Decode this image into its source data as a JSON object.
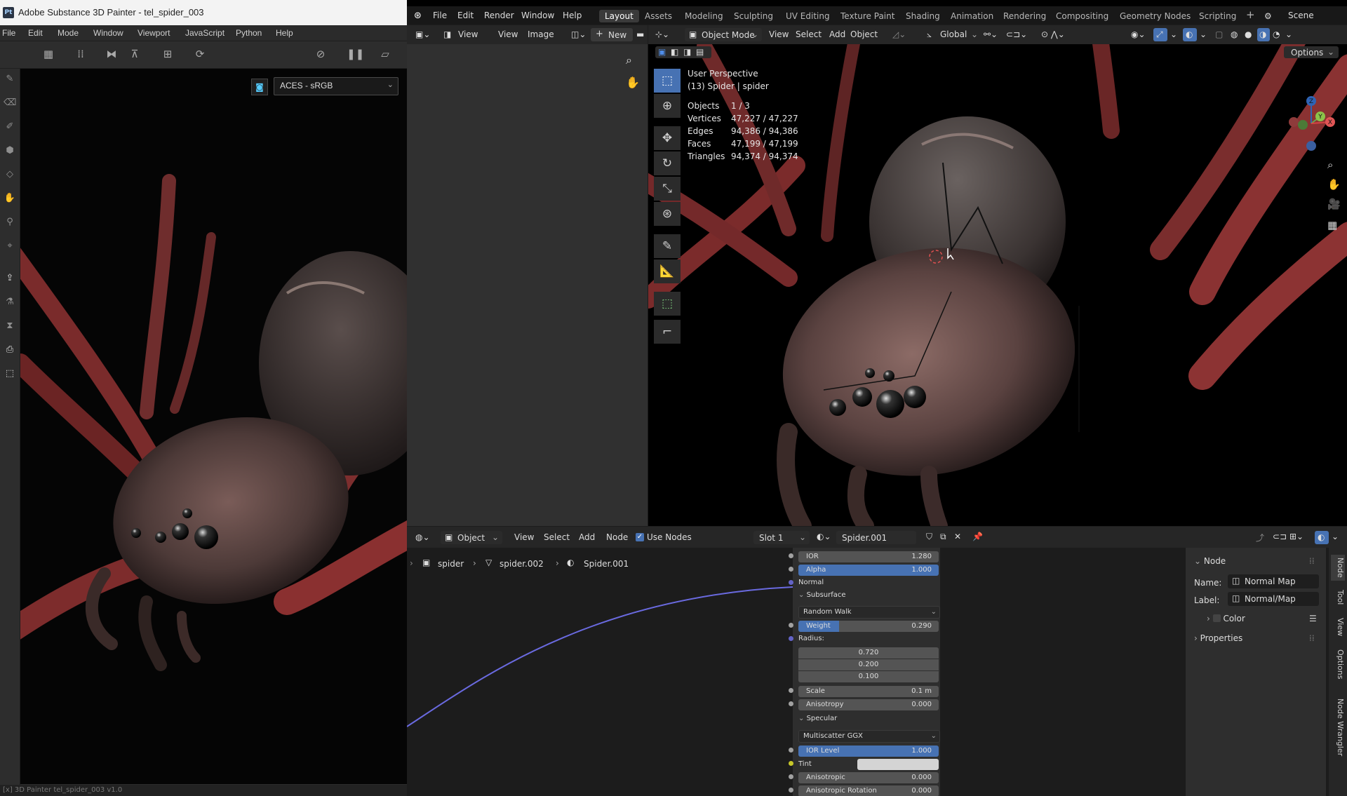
{
  "substance": {
    "title": "Adobe Substance 3D Painter - tel_spider_003",
    "logo": "Pt",
    "menu": [
      "File",
      "Edit",
      "Mode",
      "Window",
      "Viewport",
      "JavaScript",
      "Python",
      "Help"
    ],
    "colorspace": "ACES - sRGB",
    "status": "[x] 3D Painter   tel_spider_003   v1.0"
  },
  "blender": {
    "menu": [
      "File",
      "Edit",
      "Render",
      "Window",
      "Help"
    ],
    "workspaces": [
      "Layout",
      "Assets",
      "Modeling",
      "Sculpting",
      "UV Editing",
      "Texture Paint",
      "Shading",
      "Animation",
      "Rendering",
      "Compositing",
      "Geometry Nodes",
      "Scripting"
    ],
    "active_workspace": "Layout",
    "scene": "Scene",
    "image_editor": {
      "view1": "View",
      "view2": "View",
      "image": "Image",
      "new": "New"
    },
    "viewport": {
      "mode": "Object Mode",
      "menu": [
        "View",
        "Select",
        "Add",
        "Object"
      ],
      "transform": "Global",
      "options": "Options",
      "perspective": "User Perspective",
      "object_info": "(13) Spider | spider",
      "stats": [
        {
          "label": "Objects",
          "value": "1 / 3"
        },
        {
          "label": "Vertices",
          "value": "47,227 / 47,227"
        },
        {
          "label": "Edges",
          "value": "94,386 / 94,386"
        },
        {
          "label": "Faces",
          "value": "47,199 / 47,199"
        },
        {
          "label": "Triangles",
          "value": "94,374 / 94,374"
        }
      ],
      "gizmo": {
        "z": "Z",
        "y": "Y",
        "x": "X"
      }
    },
    "node_editor": {
      "mode": "Object",
      "menu": [
        "View",
        "Select",
        "Add",
        "Node"
      ],
      "use_nodes": "Use Nodes",
      "slot": "Slot 1",
      "material": "Spider.001",
      "breadcrumb": [
        "spider",
        "spider.002",
        "Spider.001"
      ],
      "props": {
        "ior": {
          "label": "IOR",
          "value": "1.280"
        },
        "alpha": {
          "label": "Alpha",
          "value": "1.000"
        },
        "normal": "Normal",
        "subsurface": "Subsurface",
        "subsurface_method": "Random Walk",
        "weight": {
          "label": "Weight",
          "value": "0.290",
          "fraction": 0.29
        },
        "radius": "Radius:",
        "radius_values": [
          "0.720",
          "0.200",
          "0.100"
        ],
        "scale": {
          "label": "Scale",
          "value": "0.1 m"
        },
        "anisotropy": {
          "label": "Anisotropy",
          "value": "0.000"
        },
        "specular": "Specular",
        "specular_method": "Multiscatter GGX",
        "ior_level": {
          "label": "IOR Level",
          "value": "1.000"
        },
        "tint": "Tint",
        "anisotropic": {
          "label": "Anisotropic",
          "value": "0.000"
        },
        "anisotropic_rotation": {
          "label": "Anisotropic Rotation",
          "value": "0.000"
        }
      },
      "sidebar": {
        "node_header": "Node",
        "name_label": "Name:",
        "name_value": "Normal Map",
        "label_label": "Label:",
        "label_value": "Normal/Map",
        "color": "Color",
        "properties": "Properties",
        "tabs": [
          "Node",
          "Tool",
          "View",
          "Options",
          "Node Wrangler"
        ]
      }
    }
  }
}
